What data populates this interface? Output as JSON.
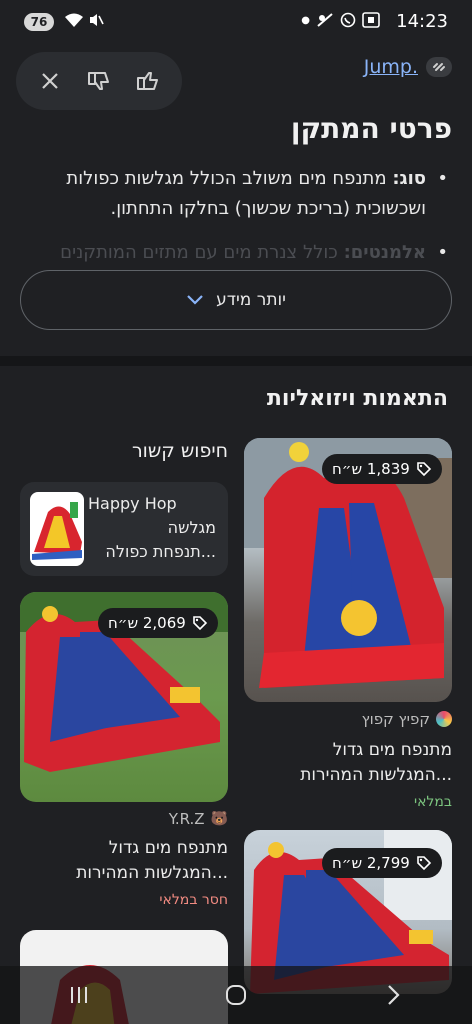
{
  "status_bar": {
    "time": "14:23",
    "battery": "76"
  },
  "feedback": {
    "close_icon": "close-icon",
    "dislike_icon": "thumbs-down-icon",
    "like_icon": "thumbs-up-icon"
  },
  "source_link": {
    "label": "Jump."
  },
  "details": {
    "title": "פרטי המתקן",
    "type_label": "סוג:",
    "type_text": "מתנפח מים משולב הכולל מגלשות כפולות ושכשוכית (בריכת שכשוך) בחלקו התחתון.",
    "elements_label": "אלמנטים:",
    "elements_text": "כולל צנרת מים עם מתזים המותקנים",
    "more_button": "יותר מידע"
  },
  "visual": {
    "title": "התאמות ויזואליות",
    "related_title": "חיפוש קשור",
    "related_item": {
      "line1": "Happy Hop",
      "line2": "מגלשה",
      "line3": "...תנפחת כפולה"
    },
    "cards": [
      {
        "price": "1,839 ש״ח",
        "source": "קפיץ קפוץ",
        "desc1": "מתנפח מים גדול",
        "desc2": "...המגלשות המהירות",
        "stock": "במלאי",
        "stock_color": "#7cc47f"
      },
      {
        "price": "2,069 ש״ח",
        "source": "Y.R.Z",
        "desc1": "מתנפח מים גדול",
        "desc2": "...המגלשות המהירות",
        "stock": "חסר במלאי",
        "stock_color": "#f28b82"
      },
      {
        "price": "2,799 ש״ח"
      }
    ]
  },
  "colors": {
    "background": "#1f2023",
    "link": "#8ab4f8"
  }
}
